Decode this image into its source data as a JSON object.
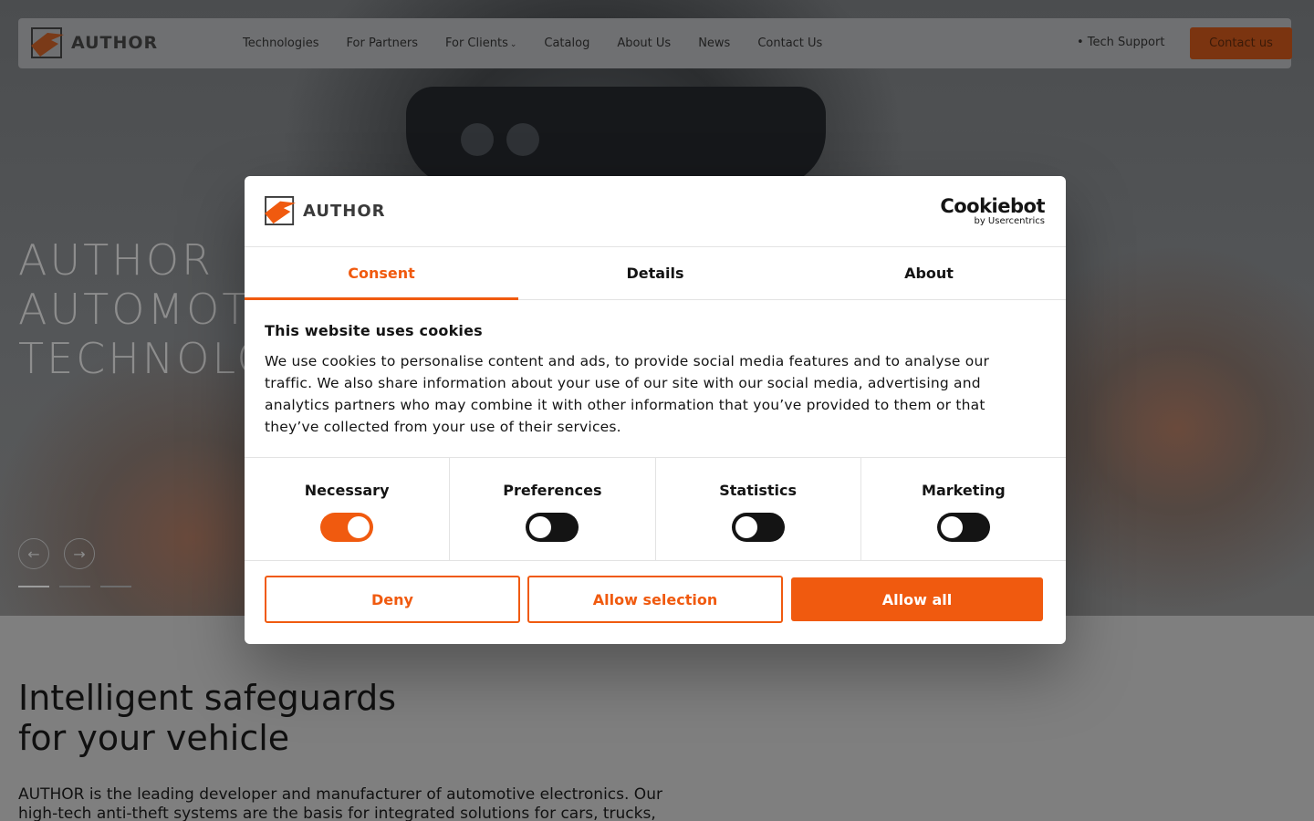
{
  "colors": {
    "accent": "#f05a0f",
    "toggle_off": "#141414",
    "overlay_header": "#6f7072"
  },
  "header": {
    "brand": "AUTHOR",
    "nav": [
      "Technologies",
      "For Partners",
      "For Clients",
      "Catalog",
      "About Us",
      "News",
      "Contact Us"
    ],
    "for_clients_has_dropdown": true,
    "tech_support": "• Tech Support",
    "contact_button": "Contact us"
  },
  "hero": {
    "title_lines": [
      "AUTHOR",
      "AUTOMOTI",
      "TECHNOLO"
    ],
    "slider_prev_icon": "arrow-left-icon",
    "slider_next_icon": "arrow-right-icon",
    "slider_dots": 3,
    "active_dot": 0
  },
  "section": {
    "heading_line1": "Intelligent safeguards",
    "heading_line2": "for your vehicle",
    "paragraph": "AUTHOR is the leading developer and manufacturer of automotive electronics. Our high-tech anti-theft systems are the basis for integrated solutions for cars, trucks, commercial"
  },
  "dialog": {
    "brand": "AUTHOR",
    "provider_name": "Cookiebot",
    "provider_sub": "by Usercentrics",
    "tabs": [
      "Consent",
      "Details",
      "About"
    ],
    "active_tab": "Consent",
    "heading": "This website uses cookies",
    "body": "We use cookies to personalise content and ads, to provide social media features and to analyse our traffic. We also share information about your use of our site with our social media, advertising and analytics partners who may combine it with other information that you’ve provided to them or that they’ve collected from your use of their services.",
    "preferences": [
      {
        "label": "Necessary",
        "on": true
      },
      {
        "label": "Preferences",
        "on": false
      },
      {
        "label": "Statistics",
        "on": false
      },
      {
        "label": "Marketing",
        "on": false
      }
    ],
    "buttons": {
      "deny": "Deny",
      "allow_selection": "Allow selection",
      "allow_all": "Allow all"
    }
  }
}
